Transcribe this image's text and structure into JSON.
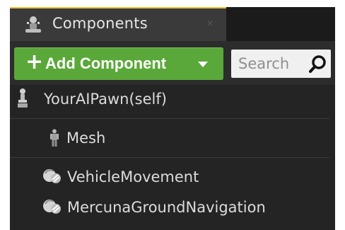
{
  "tab": {
    "title": "Components",
    "close_glyph": "×",
    "icon": "components-icon"
  },
  "toolbar": {
    "add_button": {
      "plus": "+",
      "label": "Add Component",
      "icon": "dropdown-caret-icon"
    },
    "search": {
      "placeholder": "Search",
      "icon": "search-icon"
    }
  },
  "tree": {
    "root": {
      "label": "YourAIPawn(self)",
      "icon": "pawn-icon"
    },
    "items": [
      {
        "label": "Mesh",
        "icon": "mesh-figure-icon"
      },
      {
        "label": "VehicleMovement",
        "icon": "movement-component-icon"
      },
      {
        "label": "MercunaGroundNavigation",
        "icon": "movement-component-icon"
      }
    ]
  },
  "colors": {
    "accent": "#f2c12e",
    "add_button": "#5aa83a",
    "panel": "#242424"
  }
}
